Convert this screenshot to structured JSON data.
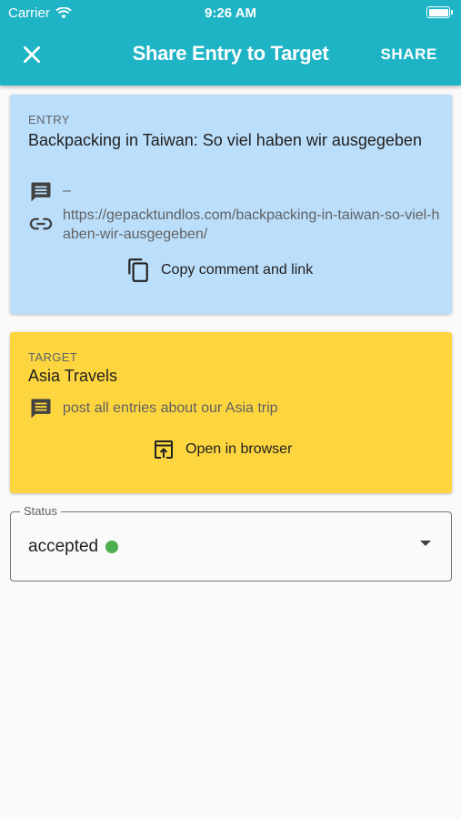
{
  "status_bar": {
    "carrier": "Carrier",
    "time": "9:26 AM"
  },
  "app_bar": {
    "title": "Share Entry to Target",
    "share_label": "SHARE",
    "close_icon": "close-icon"
  },
  "entry": {
    "overline": "ENTRY",
    "title": "Backpacking in Taiwan: So viel haben wir ausgegeben",
    "comment": "–",
    "link": "https://gepacktundlos.com/backpacking-in-taiwan-so-viel-haben-wir-ausgegeben/",
    "action_label": "Copy comment and link",
    "background": "#bbdefb"
  },
  "target": {
    "overline": "TARGET",
    "title": "Asia Travels",
    "comment": "post all entries about our Asia trip",
    "action_label": "Open in browser",
    "background": "#fdd53e"
  },
  "status": {
    "label": "Status",
    "value": "accepted",
    "indicator_color": "#4caf50"
  },
  "colors": {
    "app_bar": "#1fb3c6",
    "background": "#fafafa"
  }
}
